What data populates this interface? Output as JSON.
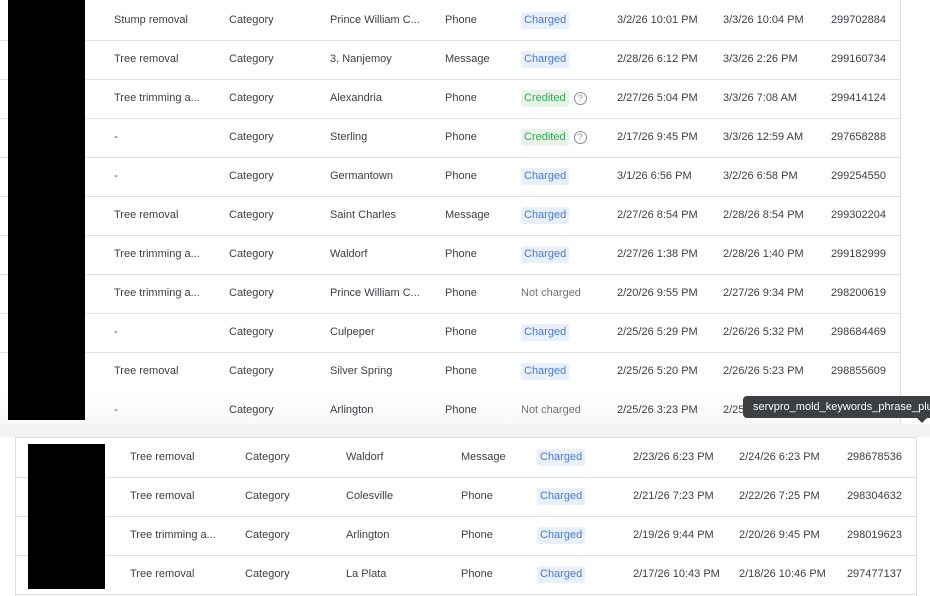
{
  "table1": {
    "rows": [
      {
        "keyword": "Stump removal",
        "category": "Category",
        "location": "Prince William C...",
        "type": "Phone",
        "status": "Charged",
        "status_kind": "charged",
        "lead_time": "3/2/26 10:01 PM",
        "charge_time": "3/3/26 10:04 PM",
        "id": "299702884"
      },
      {
        "keyword": "Tree removal",
        "category": "Category",
        "location": "3, Nanjemoy",
        "type": "Message",
        "status": "Charged",
        "status_kind": "charged",
        "lead_time": "2/28/26 6:12 PM",
        "charge_time": "3/3/26 2:26 PM",
        "id": "299160734"
      },
      {
        "keyword": "Tree trimming a...",
        "category": "Category",
        "location": "Alexandria",
        "type": "Phone",
        "status": "Credited",
        "status_kind": "credited",
        "lead_time": "2/27/26 5:04 PM",
        "charge_time": "3/3/26 7:08 AM",
        "id": "299414124"
      },
      {
        "keyword": "-",
        "category": "Category",
        "location": "Sterling",
        "type": "Phone",
        "status": "Credited",
        "status_kind": "credited",
        "lead_time": "2/17/26 9:45 PM",
        "charge_time": "3/3/26 12:59 AM",
        "id": "297658288"
      },
      {
        "keyword": "-",
        "category": "Category",
        "location": "Germantown",
        "type": "Phone",
        "status": "Charged",
        "status_kind": "charged",
        "lead_time": "3/1/26 6:56 PM",
        "charge_time": "3/2/26 6:58 PM",
        "id": "299254550"
      },
      {
        "keyword": "Tree removal",
        "category": "Category",
        "location": "Saint Charles",
        "type": "Message",
        "status": "Charged",
        "status_kind": "charged",
        "lead_time": "2/27/26 8:54 PM",
        "charge_time": "2/28/26 8:54 PM",
        "id": "299302204"
      },
      {
        "keyword": "Tree trimming a...",
        "category": "Category",
        "location": "Waldorf",
        "type": "Phone",
        "status": "Charged",
        "status_kind": "charged",
        "lead_time": "2/27/26 1:38 PM",
        "charge_time": "2/28/26 1:40 PM",
        "id": "299182999"
      },
      {
        "keyword": "Tree trimming a...",
        "category": "Category",
        "location": "Prince William C...",
        "type": "Phone",
        "status": "Not charged",
        "status_kind": "notcharged",
        "lead_time": "2/20/26 9:55 PM",
        "charge_time": "2/27/26 9:34 PM",
        "id": "298200619"
      },
      {
        "keyword": "-",
        "category": "Category",
        "location": "Culpeper",
        "type": "Phone",
        "status": "Charged",
        "status_kind": "charged",
        "lead_time": "2/25/26 5:29 PM",
        "charge_time": "2/26/26 5:32 PM",
        "id": "298684469"
      },
      {
        "keyword": "Tree removal",
        "category": "Category",
        "location": "Silver Spring",
        "type": "Phone",
        "status": "Charged",
        "status_kind": "charged",
        "lead_time": "2/25/26 5:20 PM",
        "charge_time": "2/26/26 5:23 PM",
        "id": "298855609"
      },
      {
        "keyword": "-",
        "category": "Category",
        "location": "Arlington",
        "type": "Phone",
        "status": "Not charged",
        "status_kind": "notcharged",
        "lead_time": "2/25/26 3:23 PM",
        "charge_time": "2/25",
        "id": ""
      }
    ]
  },
  "tooltip": {
    "text": "servpro_mold_keywords_phrase_plu"
  },
  "table2": {
    "rows": [
      {
        "keyword": "Tree removal",
        "category": "Category",
        "location": "Waldorf",
        "type": "Message",
        "status": "Charged",
        "status_kind": "charged",
        "lead_time": "2/23/26 6:23 PM",
        "charge_time": "2/24/26 6:23 PM",
        "id": "298678536"
      },
      {
        "keyword": "Tree removal",
        "category": "Category",
        "location": "Colesville",
        "type": "Phone",
        "status": "Charged",
        "status_kind": "charged",
        "lead_time": "2/21/26 7:23 PM",
        "charge_time": "2/22/26 7:25 PM",
        "id": "298304632"
      },
      {
        "keyword": "Tree trimming a...",
        "category": "Category",
        "location": "Arlington",
        "type": "Phone",
        "status": "Charged",
        "status_kind": "charged",
        "lead_time": "2/19/26 9:44 PM",
        "charge_time": "2/20/26 9:45 PM",
        "id": "298019623"
      },
      {
        "keyword": "Tree removal",
        "category": "Category",
        "location": "La Plata",
        "type": "Phone",
        "status": "Charged",
        "status_kind": "charged",
        "lead_time": "2/17/26 10:43 PM",
        "charge_time": "2/18/26 10:46 PM",
        "id": "297477137"
      }
    ]
  },
  "icons": {
    "help": "help-circle-icon"
  }
}
